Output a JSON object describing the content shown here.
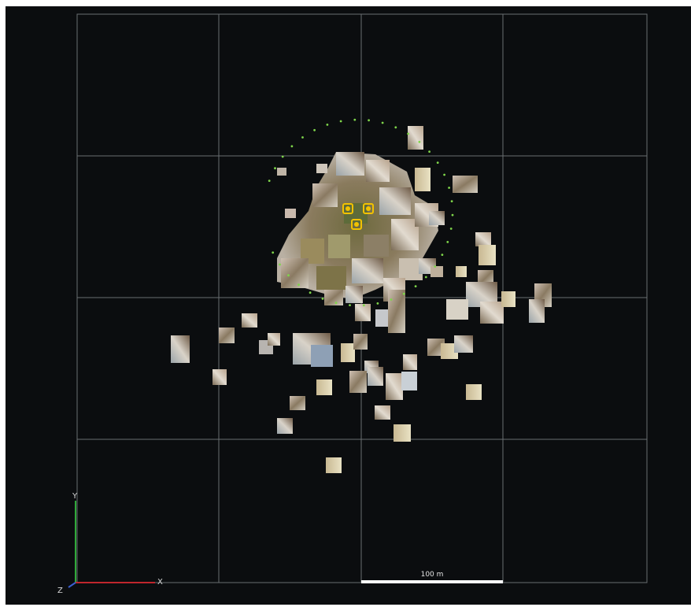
{
  "viewer": {
    "axes": {
      "x_label": "X",
      "y_label": "Y",
      "z_label": "Z"
    },
    "scale_bar": {
      "label": "100 m"
    },
    "colors": {
      "background": "#0b0d0f",
      "grid": "#6a6e72",
      "trajectory": "#7fd64a",
      "gcp": "#f2c200",
      "axis_x": "#c0262c",
      "axis_y": "#2fa83a"
    },
    "icons": [
      "gcp-marker-icon",
      "gcp-marker-icon",
      "gcp-marker-icon"
    ]
  }
}
